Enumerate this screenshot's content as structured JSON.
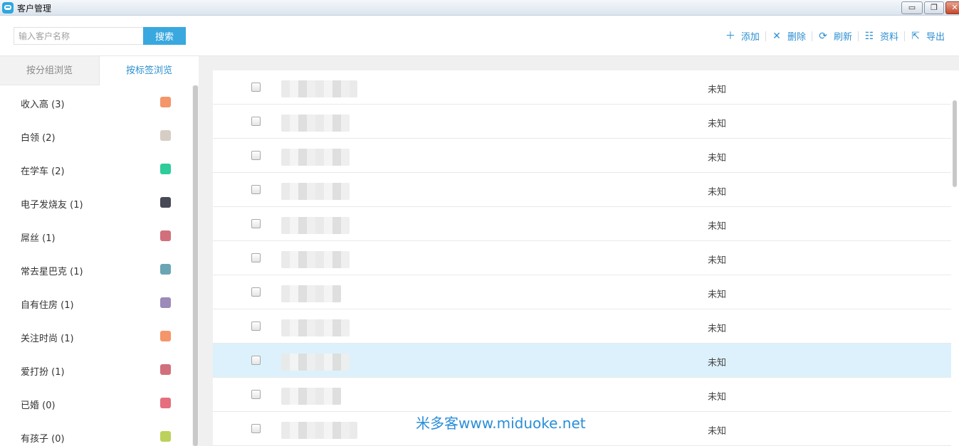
{
  "window": {
    "title": "客户管理",
    "minimize_label": "▭",
    "restore_label": "❐",
    "close_label": "✕"
  },
  "toolbar": {
    "search_placeholder": "输入客户名称",
    "search_button": "搜索",
    "actions": [
      {
        "label": "添加",
        "icon": "plus-icon",
        "glyph": "＋"
      },
      {
        "label": "删除",
        "icon": "close-x-icon",
        "glyph": "✕"
      },
      {
        "label": "刷新",
        "icon": "refresh-icon",
        "glyph": "⟳"
      },
      {
        "label": "资料",
        "icon": "profile-card-icon",
        "glyph": "☷"
      },
      {
        "label": "导出",
        "icon": "export-icon",
        "glyph": "⇱"
      }
    ]
  },
  "sidebar": {
    "tabs": [
      {
        "label": "按分组浏览",
        "active": false
      },
      {
        "label": "按标签浏览",
        "active": true
      }
    ],
    "tags": [
      {
        "label": "收入高 (3)",
        "color": "#f4956a"
      },
      {
        "label": "白领 (2)",
        "color": "#d6cdc4"
      },
      {
        "label": "在学车 (2)",
        "color": "#2ecc9a"
      },
      {
        "label": "电子发烧友 (1)",
        "color": "#474a55"
      },
      {
        "label": "屌丝 (1)",
        "color": "#d1707c"
      },
      {
        "label": "常去星巴克 (1)",
        "color": "#6aa5b3"
      },
      {
        "label": "自有住房 (1)",
        "color": "#9c8ab8"
      },
      {
        "label": "关注时尚 (1)",
        "color": "#f4956a"
      },
      {
        "label": "爱打扮 (1)",
        "color": "#d1707c"
      },
      {
        "label": "已婚 (0)",
        "color": "#e56f7f"
      },
      {
        "label": "有孩子 (0)",
        "color": "#bcd15c"
      }
    ]
  },
  "table": {
    "rows": [
      {
        "status": "未知",
        "selected": false
      },
      {
        "status": "未知",
        "selected": false
      },
      {
        "status": "未知",
        "selected": false
      },
      {
        "status": "未知",
        "selected": false
      },
      {
        "status": "未知",
        "selected": false
      },
      {
        "status": "未知",
        "selected": false
      },
      {
        "status": "未知",
        "selected": false
      },
      {
        "status": "未知",
        "selected": false
      },
      {
        "status": "未知",
        "selected": true
      },
      {
        "status": "未知",
        "selected": false
      },
      {
        "status": "未知",
        "selected": false
      }
    ]
  },
  "watermark": "米多客www.miduoke.net"
}
